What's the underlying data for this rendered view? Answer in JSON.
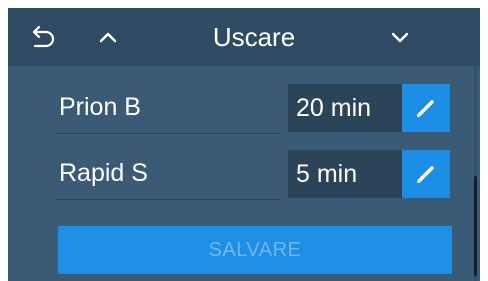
{
  "header": {
    "title": "Uscare",
    "back_icon": "undo-arrow-icon",
    "up_icon": "chevron-up-icon",
    "down_icon": "chevron-down-icon"
  },
  "rows": [
    {
      "label": "Prion B",
      "value": "20 min",
      "edit_icon": "pencil-icon"
    },
    {
      "label": "Rapid S",
      "value": "5 min",
      "edit_icon": "pencil-icon"
    }
  ],
  "save_label": "SALVARE",
  "colors": {
    "background": "#3b5a75",
    "header": "#2f4b64",
    "value_box": "#2c4459",
    "accent": "#1d8ee6",
    "disabled_text": "#6fb6ee"
  }
}
